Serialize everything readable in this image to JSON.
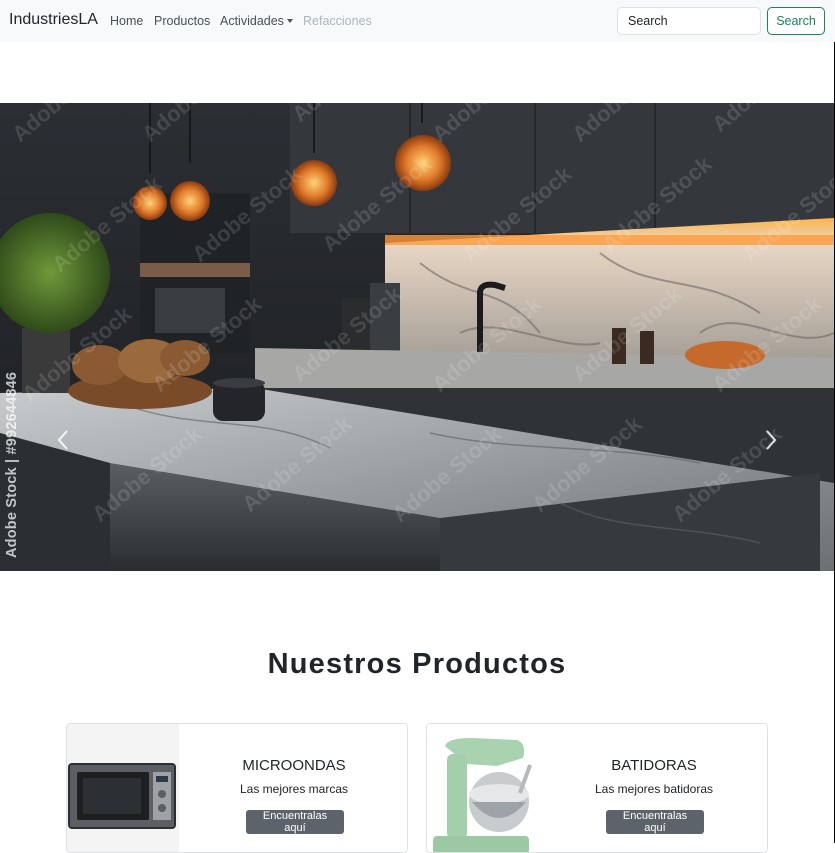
{
  "navbar": {
    "brand": "IndustriesLA",
    "links": [
      {
        "label": "Home"
      },
      {
        "label": "Productos"
      },
      {
        "label": "Actividades"
      },
      {
        "label": "Refacciones"
      }
    ],
    "search": {
      "placeholder": "Search",
      "button_label": "Search"
    }
  },
  "carousel": {
    "watermark_id": "Adobe Stock | #992644846",
    "watermark_text": "Adobe Stock",
    "prev_icon": "chevron-left-icon",
    "next_icon": "chevron-right-icon"
  },
  "products": {
    "title": "Nuestros Productos",
    "cards": [
      {
        "title": "MICROONDAS",
        "text": "Las mejores marcas",
        "button": "Encuentralas aquí",
        "image": "microwave-image"
      },
      {
        "title": "BATIDORAS",
        "text": "Las mejores batidoras",
        "button": "Encuentralas aquí",
        "image": "stand-mixer-image"
      }
    ]
  },
  "colors": {
    "navbar_bg": "#f8f9fa",
    "success": "#198754",
    "secondary": "#5c636a"
  }
}
